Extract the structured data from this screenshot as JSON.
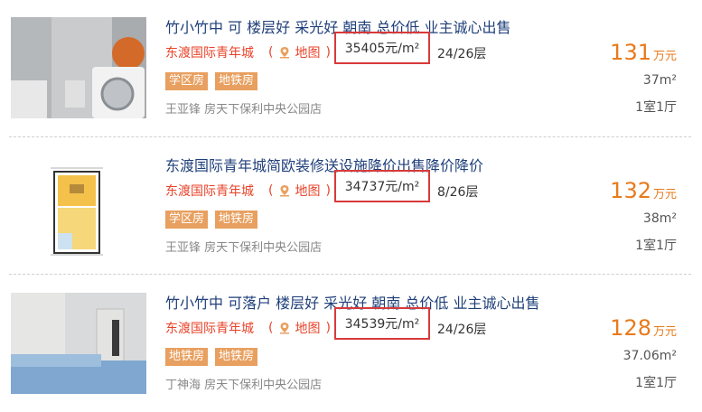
{
  "listings": [
    {
      "title": "竹小竹中 可 楼层好 采光好 朝南 总价低 业主诚心出售",
      "community": "东渡国际青年城",
      "map_label": "地图",
      "paren_open": "(",
      "paren_close": ")",
      "unit_price": "35405元/m²",
      "floor": "24/26层",
      "tags": [
        "学区房",
        "地铁房"
      ],
      "agent": "王亚锋 房天下保利中央公园店",
      "price": "131",
      "price_unit": "万元",
      "area": "37m²",
      "layout": "1室1厅"
    },
    {
      "title": "东渡国际青年城简欧装修送设施降价出售降价降价",
      "community": "东渡国际青年城",
      "map_label": "地图",
      "paren_open": "(",
      "paren_close": ")",
      "unit_price": "34737元/m²",
      "floor": "8/26层",
      "tags": [
        "学区房",
        "地铁房"
      ],
      "agent": "王亚锋 房天下保利中央公园店",
      "price": "132",
      "price_unit": "万元",
      "area": "38m²",
      "layout": "1室1厅"
    },
    {
      "title": "竹小竹中 可落户 楼层好 采光好 朝南 总价低 业主诚心出售",
      "community": "东渡国际青年城",
      "map_label": "地图",
      "paren_open": "(",
      "paren_close": ")",
      "unit_price": "34539元/m²",
      "floor": "24/26层",
      "tags": [
        "地铁房",
        "地铁房"
      ],
      "agent": "丁神海 房天下保利中央公园店",
      "price": "128",
      "price_unit": "万元",
      "area": "37.06m²",
      "layout": "1室1厅"
    }
  ],
  "colors": {
    "title": "#1f3f7a",
    "community": "#e8432a",
    "price": "#e87a1a",
    "tag_bg": "#e8a060",
    "highlight_box": "#d83a3a"
  },
  "icons": {
    "map": "map-pin-icon"
  }
}
